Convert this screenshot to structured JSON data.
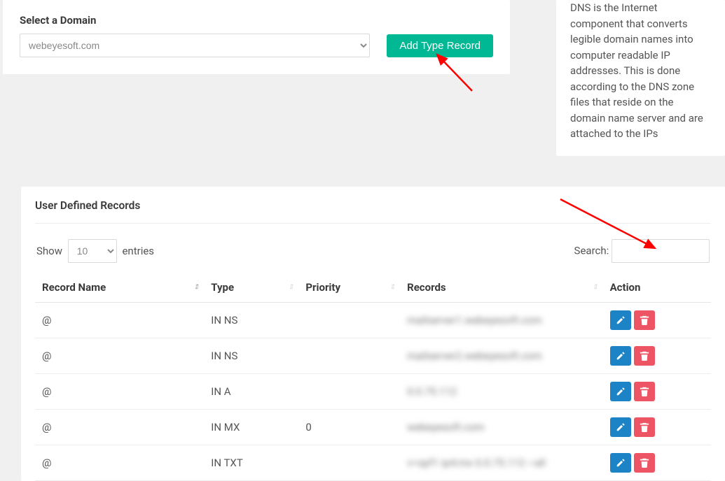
{
  "domain_panel": {
    "label": "Select a Domain",
    "selected": "webeyesoft.com",
    "add_btn": "Add Type Record"
  },
  "info": {
    "text": "DNS is the Internet component that converts legible domain names into computer readable IP addresses. This is done according to the DNS zone files that reside on the domain name server and are attached to the IPs"
  },
  "records": {
    "title": "User Defined Records",
    "show_label_pre": "Show",
    "show_label_post": "entries",
    "entries": "10",
    "search_label": "Search:",
    "cols": {
      "name": "Record Name",
      "type": "Type",
      "priority": "Priority",
      "record": "Records",
      "action": "Action"
    },
    "rows": [
      {
        "name": "@",
        "type": "IN NS",
        "priority": "",
        "record": "mailserver1.webeyesoft.com"
      },
      {
        "name": "@",
        "type": "IN NS",
        "priority": "",
        "record": "mailserver2.webeyesoft.com"
      },
      {
        "name": "@",
        "type": "IN A",
        "priority": "",
        "record": "0.0.75.112"
      },
      {
        "name": "@",
        "type": "IN MX",
        "priority": "0",
        "record": "webeyesoft.com"
      },
      {
        "name": "@",
        "type": "IN TXT",
        "priority": "",
        "record": "v=spf1 ip4:mx 0.0.75.112 ~all"
      }
    ]
  }
}
